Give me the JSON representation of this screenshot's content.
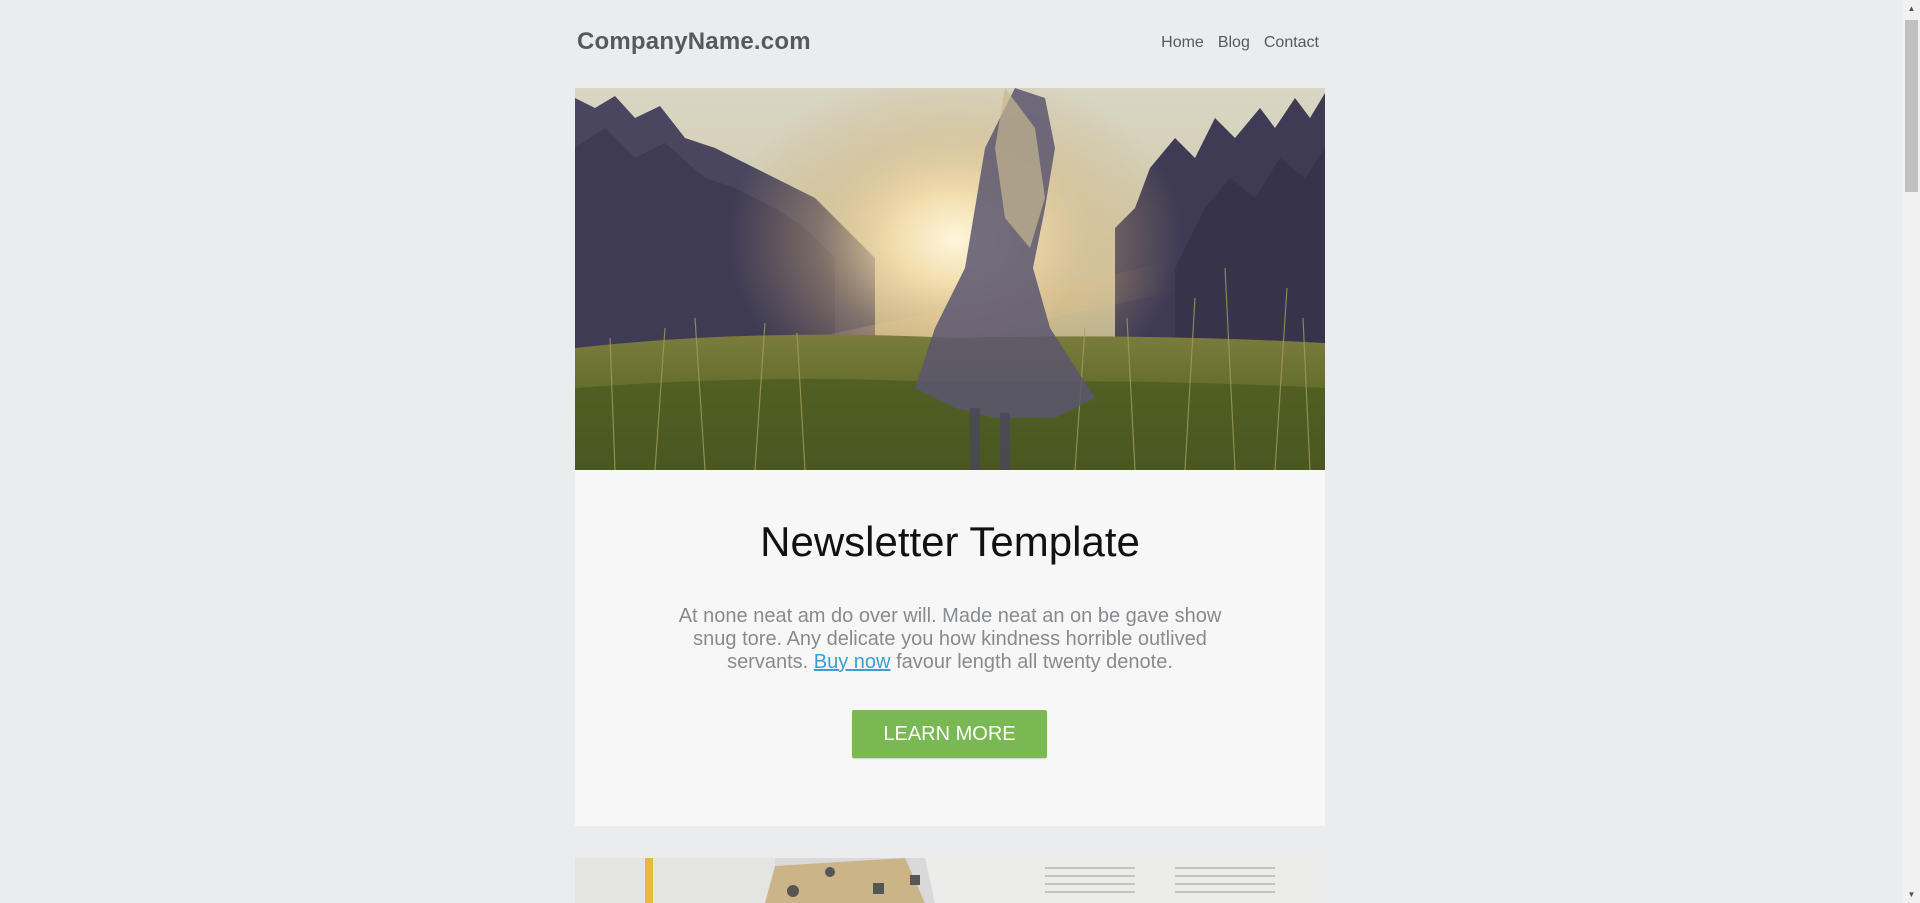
{
  "header": {
    "logo": "CompanyName.com",
    "nav": [
      "Home",
      "Blog",
      "Contact"
    ]
  },
  "hero": {
    "image": "woman-in-sunlit-meadow"
  },
  "card": {
    "title": "Newsletter Template",
    "body_before": "At none neat am do over will. Made neat an on be gave show snug tore. Any delicate you how kindness horrible outlived servants.",
    "link": "Buy now",
    "body_after": "favour length all twenty denote.",
    "button": "LEARN MORE"
  },
  "second_image": {
    "image": "open-book-with-icons"
  },
  "colors": {
    "background": "#ebecee",
    "card": "#f7f7f7",
    "button": "#7ab853",
    "link": "#3aa0d4"
  },
  "icons": {
    "scroll_up": "scroll-up-arrow-icon",
    "scroll_down": "scroll-down-arrow-icon"
  }
}
